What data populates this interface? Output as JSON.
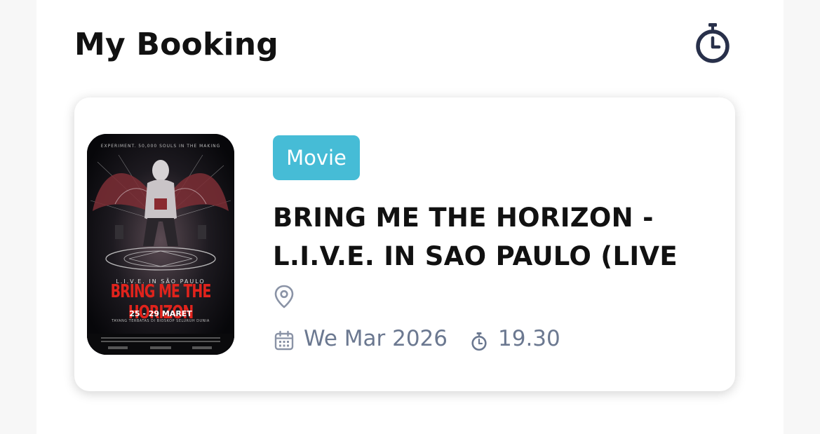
{
  "header": {
    "title": "My Booking",
    "history_icon": "stopwatch-icon"
  },
  "booking": {
    "category": "Movie",
    "title_line1": "BRING ME THE HORIZON -",
    "title_line2": "L.I.V.E. IN SAO PAULO (LIVE",
    "location": "",
    "date": "We Mar 2026",
    "time": "19.30",
    "poster": {
      "top_text": "EXPERIMENT. 50,000 SOULS IN THE MAKING",
      "subtitle": "L.I.V.E.   IN   SÃO   PAULO",
      "band": "BRING ME THE HORIZON",
      "dates": "25 - 29 MARET",
      "note": "TAYANG TERBATAS DI BIOSKOP SELURUH DUNIA"
    }
  },
  "colors": {
    "badge": "#46bcd6",
    "icon_dark": "#28304a",
    "meta_text": "#6b7890",
    "poster_red": "#e0231c"
  },
  "icons": {
    "location": "map-pin-icon",
    "date": "calendar-icon",
    "time": "stopwatch-icon"
  }
}
